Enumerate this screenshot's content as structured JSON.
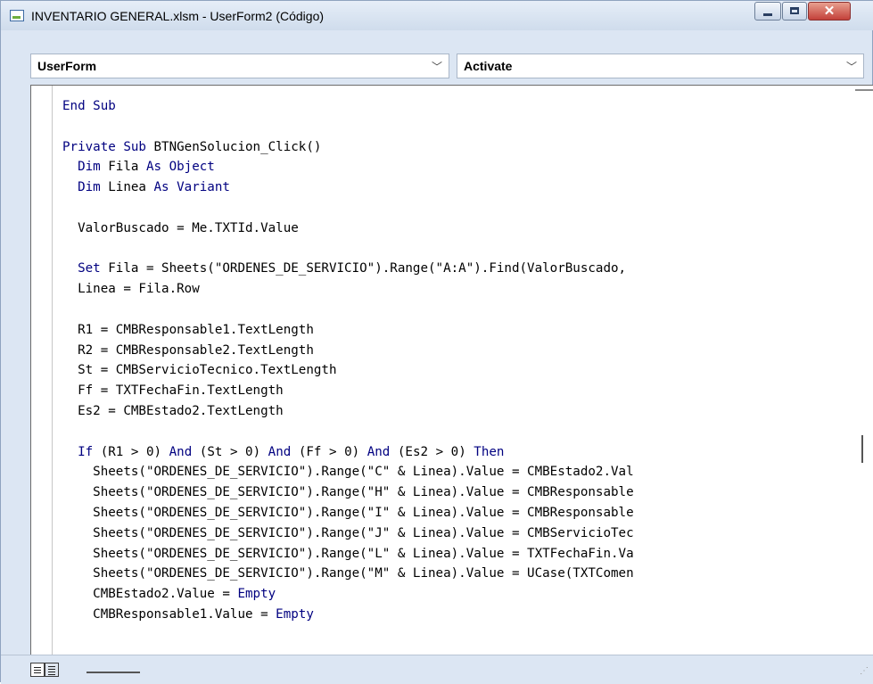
{
  "window": {
    "title": "INVENTARIO GENERAL.xlsm - UserForm2 (Código)",
    "close_label": "✕"
  },
  "object_combo": {
    "value": "UserForm"
  },
  "procedure_combo": {
    "value": "Activate"
  },
  "code_lines": [
    [
      [
        "k",
        "End Sub"
      ]
    ],
    [],
    [
      [
        "k",
        "Private Sub "
      ],
      [
        "t",
        "BTNGenSolucion_Click()"
      ]
    ],
    [
      [
        "t",
        "  "
      ],
      [
        "k",
        "Dim"
      ],
      [
        "t",
        " Fila "
      ],
      [
        "k",
        "As Object"
      ]
    ],
    [
      [
        "t",
        "  "
      ],
      [
        "k",
        "Dim"
      ],
      [
        "t",
        " Linea "
      ],
      [
        "k",
        "As Variant"
      ]
    ],
    [],
    [
      [
        "t",
        "  ValorBuscado = Me.TXTId.Value"
      ]
    ],
    [],
    [
      [
        "t",
        "  "
      ],
      [
        "k",
        "Set"
      ],
      [
        "t",
        " Fila = Sheets(\"ORDENES_DE_SERVICIO\").Range(\"A:A\").Find(ValorBuscado,"
      ]
    ],
    [
      [
        "t",
        "  Linea = Fila.Row"
      ]
    ],
    [],
    [
      [
        "t",
        "  R1 = CMBResponsable1.TextLength"
      ]
    ],
    [
      [
        "t",
        "  R2 = CMBResponsable2.TextLength"
      ]
    ],
    [
      [
        "t",
        "  St = CMBServicioTecnico.TextLength"
      ]
    ],
    [
      [
        "t",
        "  Ff = TXTFechaFin.TextLength"
      ]
    ],
    [
      [
        "t",
        "  Es2 = CMBEstado2.TextLength"
      ]
    ],
    [],
    [
      [
        "t",
        "  "
      ],
      [
        "k",
        "If"
      ],
      [
        "t",
        " (R1 > 0) "
      ],
      [
        "k",
        "And"
      ],
      [
        "t",
        " (St > 0) "
      ],
      [
        "k",
        "And"
      ],
      [
        "t",
        " (Ff > 0) "
      ],
      [
        "k",
        "And"
      ],
      [
        "t",
        " (Es2 > 0) "
      ],
      [
        "k",
        "Then"
      ]
    ],
    [
      [
        "t",
        "    Sheets(\"ORDENES_DE_SERVICIO\").Range(\"C\" & Linea).Value = CMBEstado2.Val"
      ]
    ],
    [
      [
        "t",
        "    Sheets(\"ORDENES_DE_SERVICIO\").Range(\"H\" & Linea).Value = CMBResponsable"
      ]
    ],
    [
      [
        "t",
        "    Sheets(\"ORDENES_DE_SERVICIO\").Range(\"I\" & Linea).Value = CMBResponsable"
      ]
    ],
    [
      [
        "t",
        "    Sheets(\"ORDENES_DE_SERVICIO\").Range(\"J\" & Linea).Value = CMBServicioTec"
      ]
    ],
    [
      [
        "t",
        "    Sheets(\"ORDENES_DE_SERVICIO\").Range(\"L\" & Linea).Value = TXTFechaFin.Va"
      ]
    ],
    [
      [
        "t",
        "    Sheets(\"ORDENES_DE_SERVICIO\").Range(\"M\" & Linea).Value = UCase(TXTComen"
      ]
    ],
    [
      [
        "t",
        "    CMBEstado2.Value = "
      ],
      [
        "k",
        "Empty"
      ]
    ],
    [
      [
        "t",
        "    CMBResponsable1.Value = "
      ],
      [
        "k",
        "Empty"
      ]
    ]
  ],
  "colors": {
    "keyword": "#000080",
    "text": "#000000"
  }
}
